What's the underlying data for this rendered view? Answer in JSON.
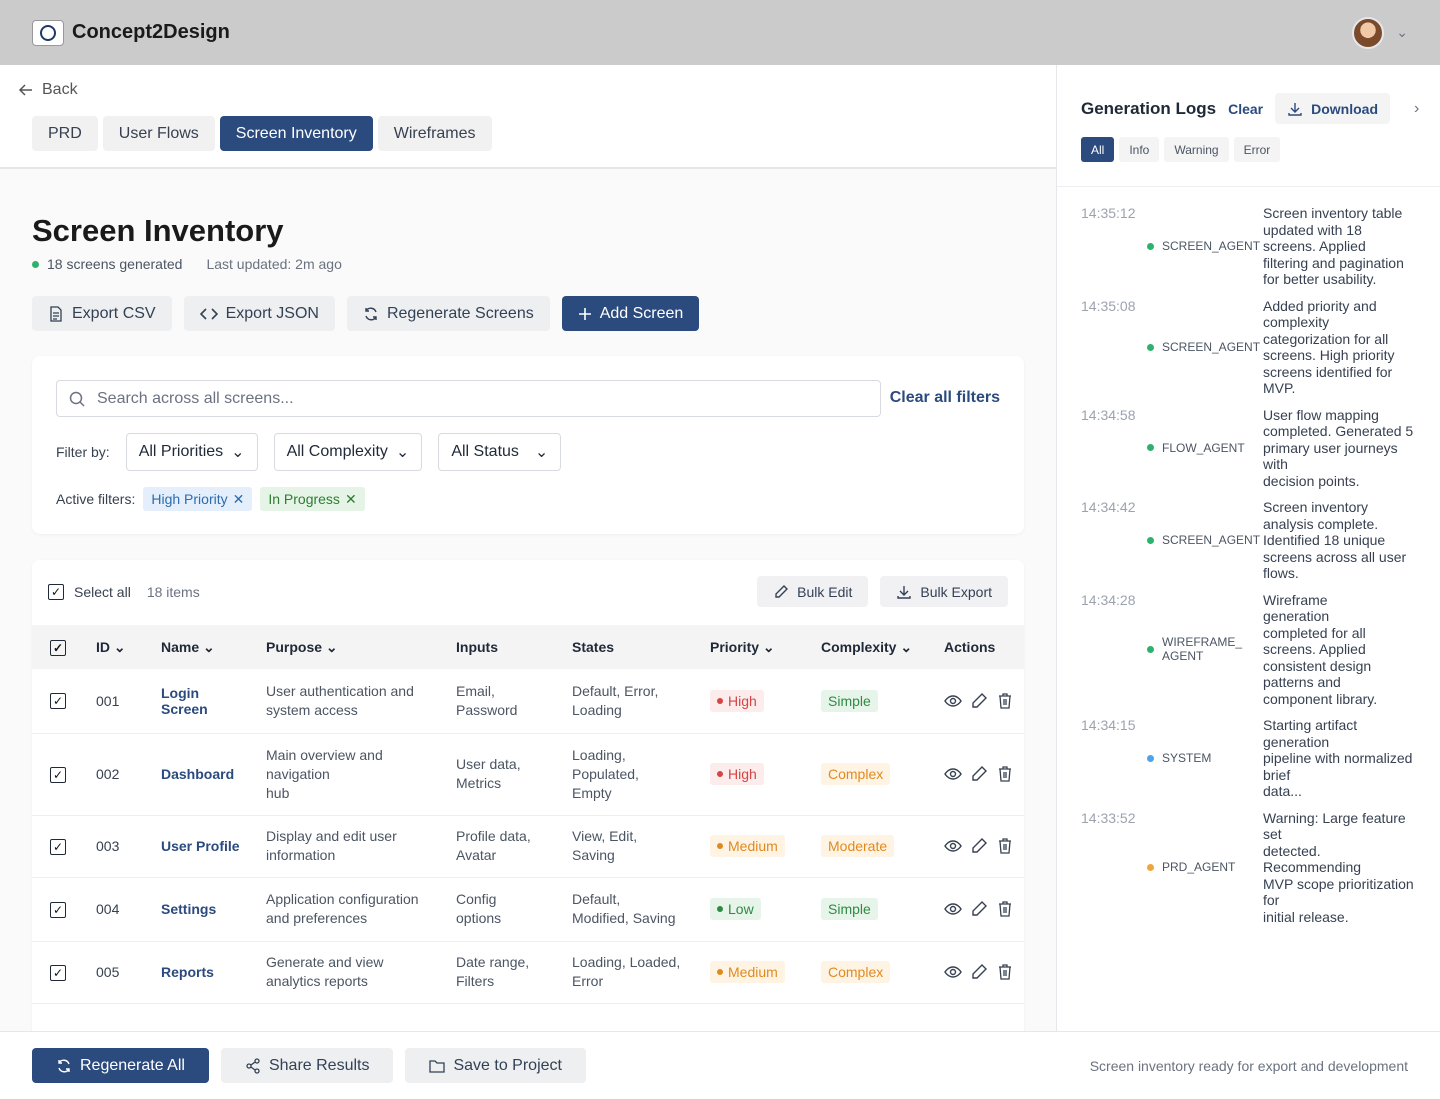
{
  "app": {
    "brand": "Concept2Design"
  },
  "nav": {
    "back_label": "Back"
  },
  "tabs": [
    {
      "label": "PRD",
      "active": false
    },
    {
      "label": "User Flows",
      "active": false
    },
    {
      "label": "Screen Inventory",
      "active": true
    },
    {
      "label": "Wireframes",
      "active": false
    }
  ],
  "page": {
    "title": "Screen Inventory",
    "generated": "18 screens generated",
    "updated": "Last updated: 2m ago"
  },
  "actions": {
    "export_csv": "Export CSV",
    "export_json": "Export JSON",
    "regenerate_screens": "Regenerate Screens",
    "add_screen": "Add Screen"
  },
  "filters": {
    "search_placeholder": "Search across all screens...",
    "clear_all": "Clear all filters",
    "filter_by": "Filter by:",
    "priority": "All Priorities",
    "complexity": "All Complexity",
    "status": "All Status",
    "active_label": "Active filters:",
    "active": [
      "High Priority",
      "In Progress"
    ]
  },
  "table": {
    "select_all": "Select all",
    "items_count": "18 items",
    "bulk_edit": "Bulk Edit",
    "bulk_export": "Bulk Export",
    "columns": [
      "ID",
      "Name",
      "Purpose",
      "Inputs",
      "States",
      "Priority",
      "Complexity",
      "Actions"
    ],
    "rows": [
      {
        "id": "001",
        "name": "Login\nScreen",
        "purpose": "User authentication and\nsystem access",
        "inputs": "Email,\nPassword",
        "states": "Default, Error,\nLoading",
        "priority": "High",
        "complexity": "Simple"
      },
      {
        "id": "002",
        "name": "Dashboard",
        "purpose": "Main overview and navigation\nhub",
        "inputs": "User data,\nMetrics",
        "states": "Loading,\nPopulated,\nEmpty",
        "priority": "High",
        "complexity": "Complex"
      },
      {
        "id": "003",
        "name": "User Profile",
        "purpose": "Display and edit user\ninformation",
        "inputs": "Profile data,\nAvatar",
        "states": "View, Edit,\nSaving",
        "priority": "Medium",
        "complexity": "Moderate"
      },
      {
        "id": "004",
        "name": "Settings",
        "purpose": "Application configuration\nand preferences",
        "inputs": "Config\noptions",
        "states": "Default,\nModified, Saving",
        "priority": "Low",
        "complexity": "Simple"
      },
      {
        "id": "005",
        "name": "Reports",
        "purpose": "Generate and view\nanalytics reports",
        "inputs": "Date range,\nFilters",
        "states": "Loading, Loaded,\nError",
        "priority": "Medium",
        "complexity": "Complex"
      }
    ]
  },
  "footer": {
    "regenerate_all": "Regenerate All",
    "share": "Share Results",
    "save": "Save to Project",
    "status": "Screen inventory ready for export and development"
  },
  "logs": {
    "title": "Generation Logs",
    "clear": "Clear",
    "download": "Download",
    "filters": [
      "All",
      "Info",
      "Warning",
      "Error"
    ],
    "entries": [
      {
        "time": "14:35:12",
        "agent": "SCREEN_AGENT",
        "color": "#2fb16e",
        "msg": "Screen inventory table\nupdated with 18\nscreens. Applied\nfiltering and pagination\nfor better usability."
      },
      {
        "time": "14:35:08",
        "agent": "SCREEN_AGENT",
        "color": "#2fb16e",
        "msg": "Added priority and\ncomplexity\ncategorization for all\nscreens. High priority\nscreens identified for\nMVP."
      },
      {
        "time": "14:34:58",
        "agent": "FLOW_AGENT",
        "color": "#2fb16e",
        "msg": "User flow mapping\ncompleted. Generated 5\nprimary user journeys\nwith\ndecision points."
      },
      {
        "time": "14:34:42",
        "agent": "SCREEN_AGENT",
        "color": "#2fb16e",
        "msg": "Screen inventory\nanalysis complete.\nIdentified 18 unique\nscreens across all user\nflows."
      },
      {
        "time": "14:34:28",
        "agent": "WIREFRAME_\nAGENT",
        "color": "#2fb16e",
        "msg": "Wireframe\ngeneration\ncompleted for all\nscreens. Applied\nconsistent design\npatterns and\ncomponent library."
      },
      {
        "time": "14:34:15",
        "agent": "SYSTEM",
        "color": "#4fa3e8",
        "msg": "Starting artifact\ngeneration\npipeline with normalized\nbrief\ndata..."
      },
      {
        "time": "14:33:52",
        "agent": "PRD_AGENT",
        "color": "#f0a53a",
        "msg": "Warning: Large feature\nset\ndetected.\nRecommending\nMVP scope prioritization\nfor\ninitial release."
      }
    ]
  }
}
